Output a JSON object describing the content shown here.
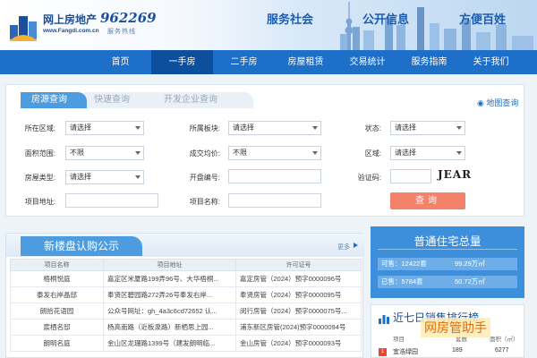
{
  "header": {
    "logo_text": "网上房地产",
    "logo_url": "www.Fangdi.com.cn",
    "hotline": "962269",
    "hotline_label": "服务热线",
    "slogans": [
      "服务社会",
      "公开信息",
      "方便百姓"
    ]
  },
  "nav": [
    "首页",
    "一手房",
    "二手房",
    "房屋租赁",
    "交易统计",
    "服务指南",
    "关于我们"
  ],
  "search": {
    "tabs": [
      "房源查询",
      "快速查询",
      "开发企业查询"
    ],
    "map_link": "地图查询",
    "labels": {
      "district": "所在区域:",
      "block": "所属板块:",
      "status": "状态:",
      "area_range": "面积范围:",
      "price": "成交均价:",
      "region": "区域:",
      "house_type": "房屋类型:",
      "license_no": "开盘编号:",
      "captcha": "验证码:",
      "address": "项目地址:",
      "name": "项目名称:"
    },
    "values": {
      "district": "请选择",
      "block": "请选择",
      "status": "请选择",
      "area_range": "不限",
      "price": "不限",
      "region": "请选择",
      "house_type": "请选择"
    },
    "captcha_text": "JEAR",
    "button": "查询"
  },
  "listing": {
    "title": "新楼盘认购公示",
    "more": "更多",
    "columns": [
      "项目名称",
      "项目地址",
      "许可证号"
    ],
    "rows": [
      [
        "梧桐悦庭",
        "嘉定区米厦路199弄96号、大华梧桐...",
        "嘉定房管（2024）预字0000096号"
      ],
      [
        "泰发右岸晶邸",
        "奉贤区碧园路272弄26号奉发右岸...",
        "奉贤房管（2024）预字0000095号"
      ],
      [
        "朗拾花语园",
        "公众号网址：gh_4a3c6cd72652 认...",
        "闵行房管（2024）预字0000075号..."
      ],
      [
        "宸栖名邸",
        "杨高南路（近板泉路）新栖思上园...",
        "浦东新区房管(2024)预字0000094号"
      ],
      [
        "朗明名庭",
        "金山区龙珊路1399号（建发朗明临...",
        "金山房管（2024）预字0000093号"
      ]
    ]
  },
  "stats": {
    "title": "普通住宅总量",
    "rows": [
      {
        "k": "可售：12422套",
        "v": "99.29万㎡"
      },
      {
        "k": "已售：5784套",
        "v": "50.72万㎡"
      }
    ]
  },
  "rank": {
    "title": "近七日销售排行榜",
    "columns": [
      "项目",
      "套数",
      "面积（㎡）"
    ],
    "first": {
      "no": "1",
      "name": "宜浩绿园",
      "count": "189",
      "area": "6277"
    }
  },
  "watermark": "网房管助手"
}
